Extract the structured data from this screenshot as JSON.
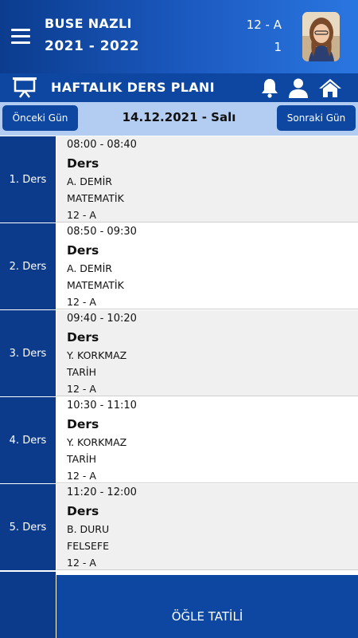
{
  "header": {
    "student_name": "BUSE NAZLI",
    "school_year": "2021 - 2022",
    "class_name": "12 - A",
    "class_no": "1",
    "menu_icon": "hamburger-menu-icon",
    "avatar": "student-photo"
  },
  "titlebar": {
    "title": "HAFTALIK DERS PLANI",
    "icons": [
      "presentation-board-icon",
      "bell-icon",
      "user-icon",
      "home-icon"
    ]
  },
  "datebar": {
    "prev_label": "Önceki Gün",
    "date": "14.12.2021 - Salı",
    "next_label": "Sonraki Gün"
  },
  "lessons": [
    {
      "label": "1. Ders",
      "time": "08:00 - 08:40",
      "kind": "Ders",
      "teacher": "A. DEMİR",
      "subject": "MATEMATİK",
      "class": "12 - A"
    },
    {
      "label": "2. Ders",
      "time": "08:50 - 09:30",
      "kind": "Ders",
      "teacher": "A. DEMİR",
      "subject": "MATEMATİK",
      "class": "12 - A"
    },
    {
      "label": "3. Ders",
      "time": "09:40 - 10:20",
      "kind": "Ders",
      "teacher": "Y. KORKMAZ",
      "subject": "TARİH",
      "class": "12 - A"
    },
    {
      "label": "4. Ders",
      "time": "10:30 - 11:10",
      "kind": "Ders",
      "teacher": "Y. KORKMAZ",
      "subject": "TARİH",
      "class": "12 - A"
    },
    {
      "label": "5. Ders",
      "time": "11:20 - 12:00",
      "kind": "Ders",
      "teacher": "B. DURU",
      "subject": "FELSEFE",
      "class": "12 - A"
    }
  ],
  "lunch": {
    "label": "ÖĞLE TATİLİ"
  },
  "colors": {
    "primary": "#0d47a1",
    "row_label": "#0c3b8c",
    "date_bar": "#b3cdf2",
    "card_alt": "#f0f0f0"
  }
}
